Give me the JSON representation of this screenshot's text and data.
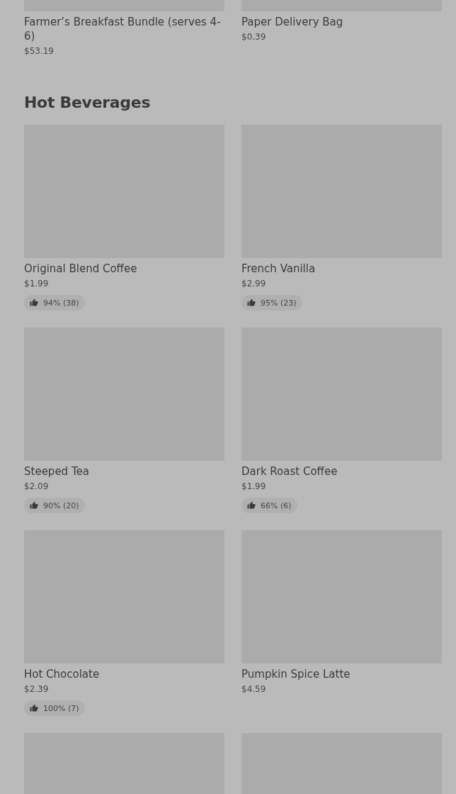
{
  "top_items": [
    {
      "kind": "item",
      "name": "Farmer’s Breakfast Bundle (serves 4-6)",
      "price": "$53.19"
    },
    {
      "kind": "item",
      "name": "Paper Delivery Bag",
      "price": "$0.39"
    }
  ],
  "section": {
    "title": "Hot Beverages",
    "items": [
      {
        "kind": "item",
        "name": "Original Blend Coffee",
        "price": "$1.99",
        "rating": "94% (38)"
      },
      {
        "kind": "item",
        "name": "French Vanilla",
        "price": "$2.99",
        "rating": "95% (23)"
      },
      {
        "kind": "item",
        "name": "Steeped Tea",
        "price": "$2.09",
        "rating": "90% (20)"
      },
      {
        "kind": "item",
        "name": "Dark Roast Coffee",
        "price": "$1.99",
        "rating": "66% (6)"
      },
      {
        "kind": "item",
        "name": "Hot Chocolate",
        "price": "$2.39",
        "rating": "100% (7)"
      },
      {
        "kind": "item",
        "name": "Pumpkin Spice Latte",
        "price": "$4.59"
      },
      {
        "kind": "image_only"
      },
      {
        "kind": "image_only"
      }
    ]
  }
}
